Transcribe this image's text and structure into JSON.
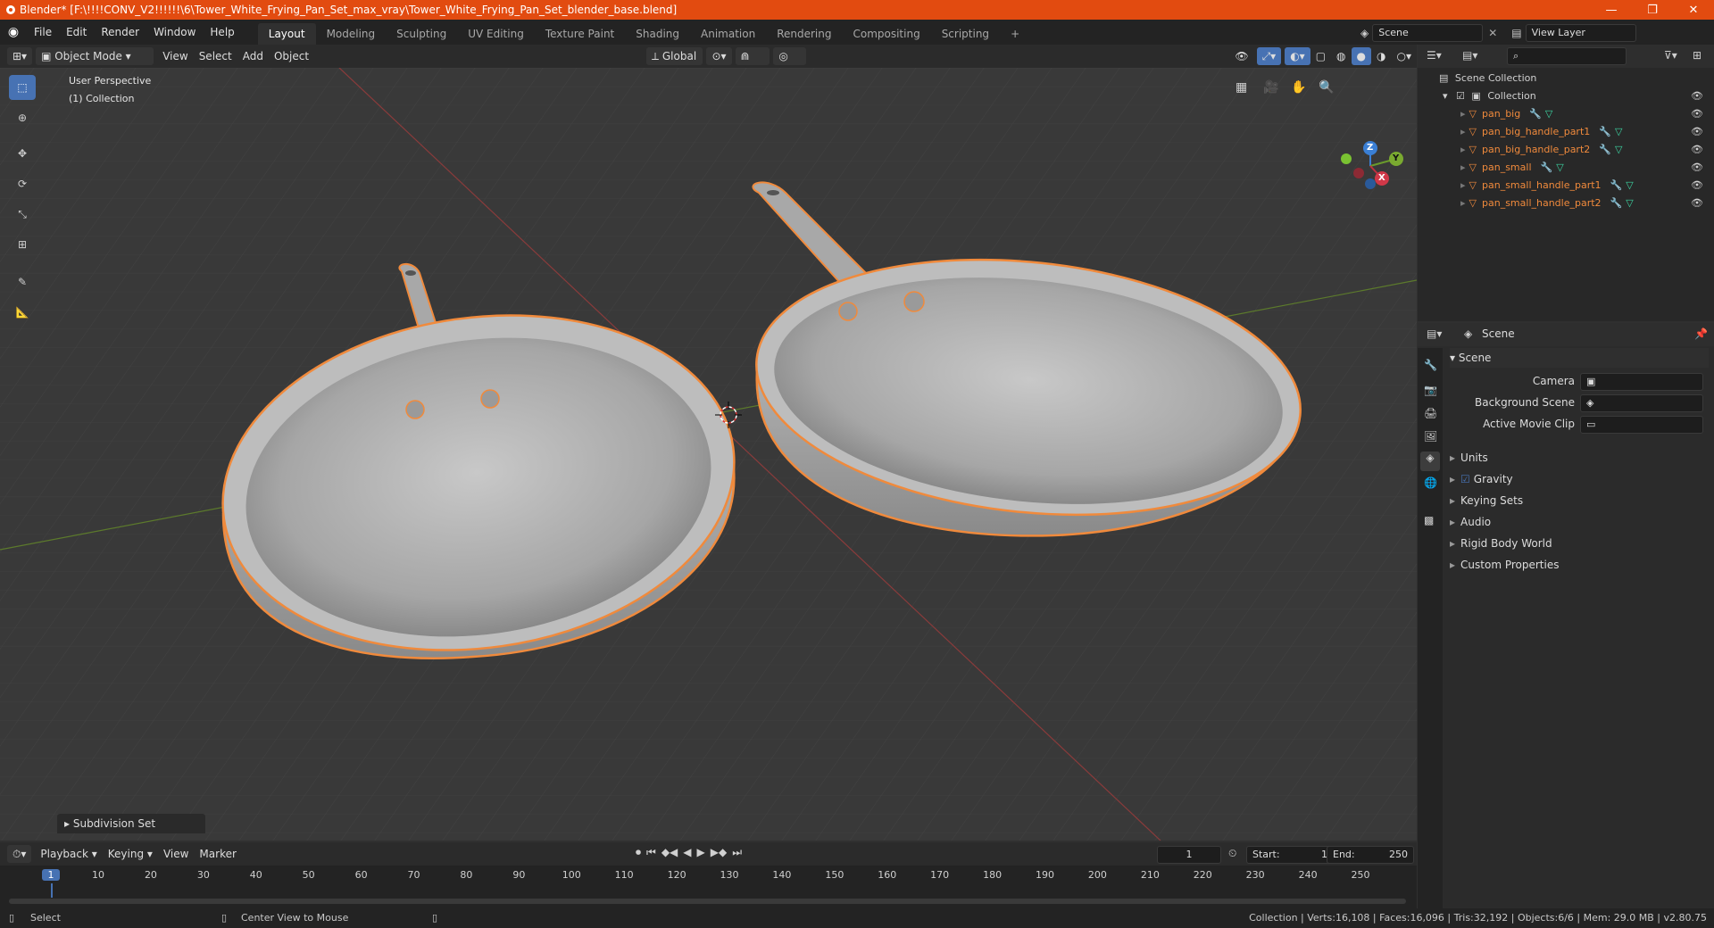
{
  "window": {
    "title": "Blender* [F:\\!!!!CONV_V2!!!!!!\\6\\Tower_White_Frying_Pan_Set_max_vray\\Tower_White_Frying_Pan_Set_blender_base.blend]",
    "minimize": "—",
    "restore": "❐",
    "close": "✕"
  },
  "menu": {
    "items": [
      "File",
      "Edit",
      "Render",
      "Window",
      "Help"
    ]
  },
  "workspaces": {
    "tabs": [
      "Layout",
      "Modeling",
      "Sculpting",
      "UV Editing",
      "Texture Paint",
      "Shading",
      "Animation",
      "Rendering",
      "Compositing",
      "Scripting"
    ],
    "active": "Layout",
    "add": "+"
  },
  "scene_field": "Scene",
  "view_layer_field": "View Layer",
  "viewport_header": {
    "mode": "Object Mode",
    "menus": [
      "View",
      "Select",
      "Add",
      "Object"
    ],
    "transform": "Global"
  },
  "viewport": {
    "perspective": "User Perspective",
    "collection": "(1) Collection",
    "operator_panel": "Subdivision Set",
    "gizmo_axes": {
      "x": "X",
      "y": "Y",
      "z": "Z"
    }
  },
  "outliner": {
    "root": "Scene Collection",
    "collection": "Collection",
    "objects": [
      "pan_big",
      "pan_big_handle_part1",
      "pan_big_handle_part2",
      "pan_small",
      "pan_small_handle_part1",
      "pan_small_handle_part2"
    ]
  },
  "properties": {
    "header": "Scene",
    "panel": "Scene",
    "camera_label": "Camera",
    "background_label": "Background Scene",
    "movie_clip_label": "Active Movie Clip",
    "sections": [
      "Units",
      "Gravity",
      "Keying Sets",
      "Audio",
      "Rigid Body World",
      "Custom Properties"
    ]
  },
  "timeline": {
    "menus": [
      "Playback",
      "Keying",
      "View",
      "Marker"
    ],
    "current_frame": "1",
    "start_label": "Start:",
    "start": "1",
    "end_label": "End:",
    "end": "250",
    "ticks": [
      "1",
      "10",
      "20",
      "30",
      "40",
      "50",
      "60",
      "70",
      "80",
      "90",
      "100",
      "110",
      "120",
      "130",
      "140",
      "150",
      "160",
      "170",
      "180",
      "190",
      "200",
      "210",
      "220",
      "230",
      "240",
      "250"
    ]
  },
  "status": {
    "left": "Select",
    "middle": "Center View to Mouse",
    "right": "Collection | Verts:16,108 | Faces:16,096 | Tris:32,192 | Objects:6/6 | Mem: 29.0 MB | v2.80.75"
  },
  "colors": {
    "accent": "#4772b3",
    "title": "#e24b10",
    "selected": "#f08a3c"
  }
}
